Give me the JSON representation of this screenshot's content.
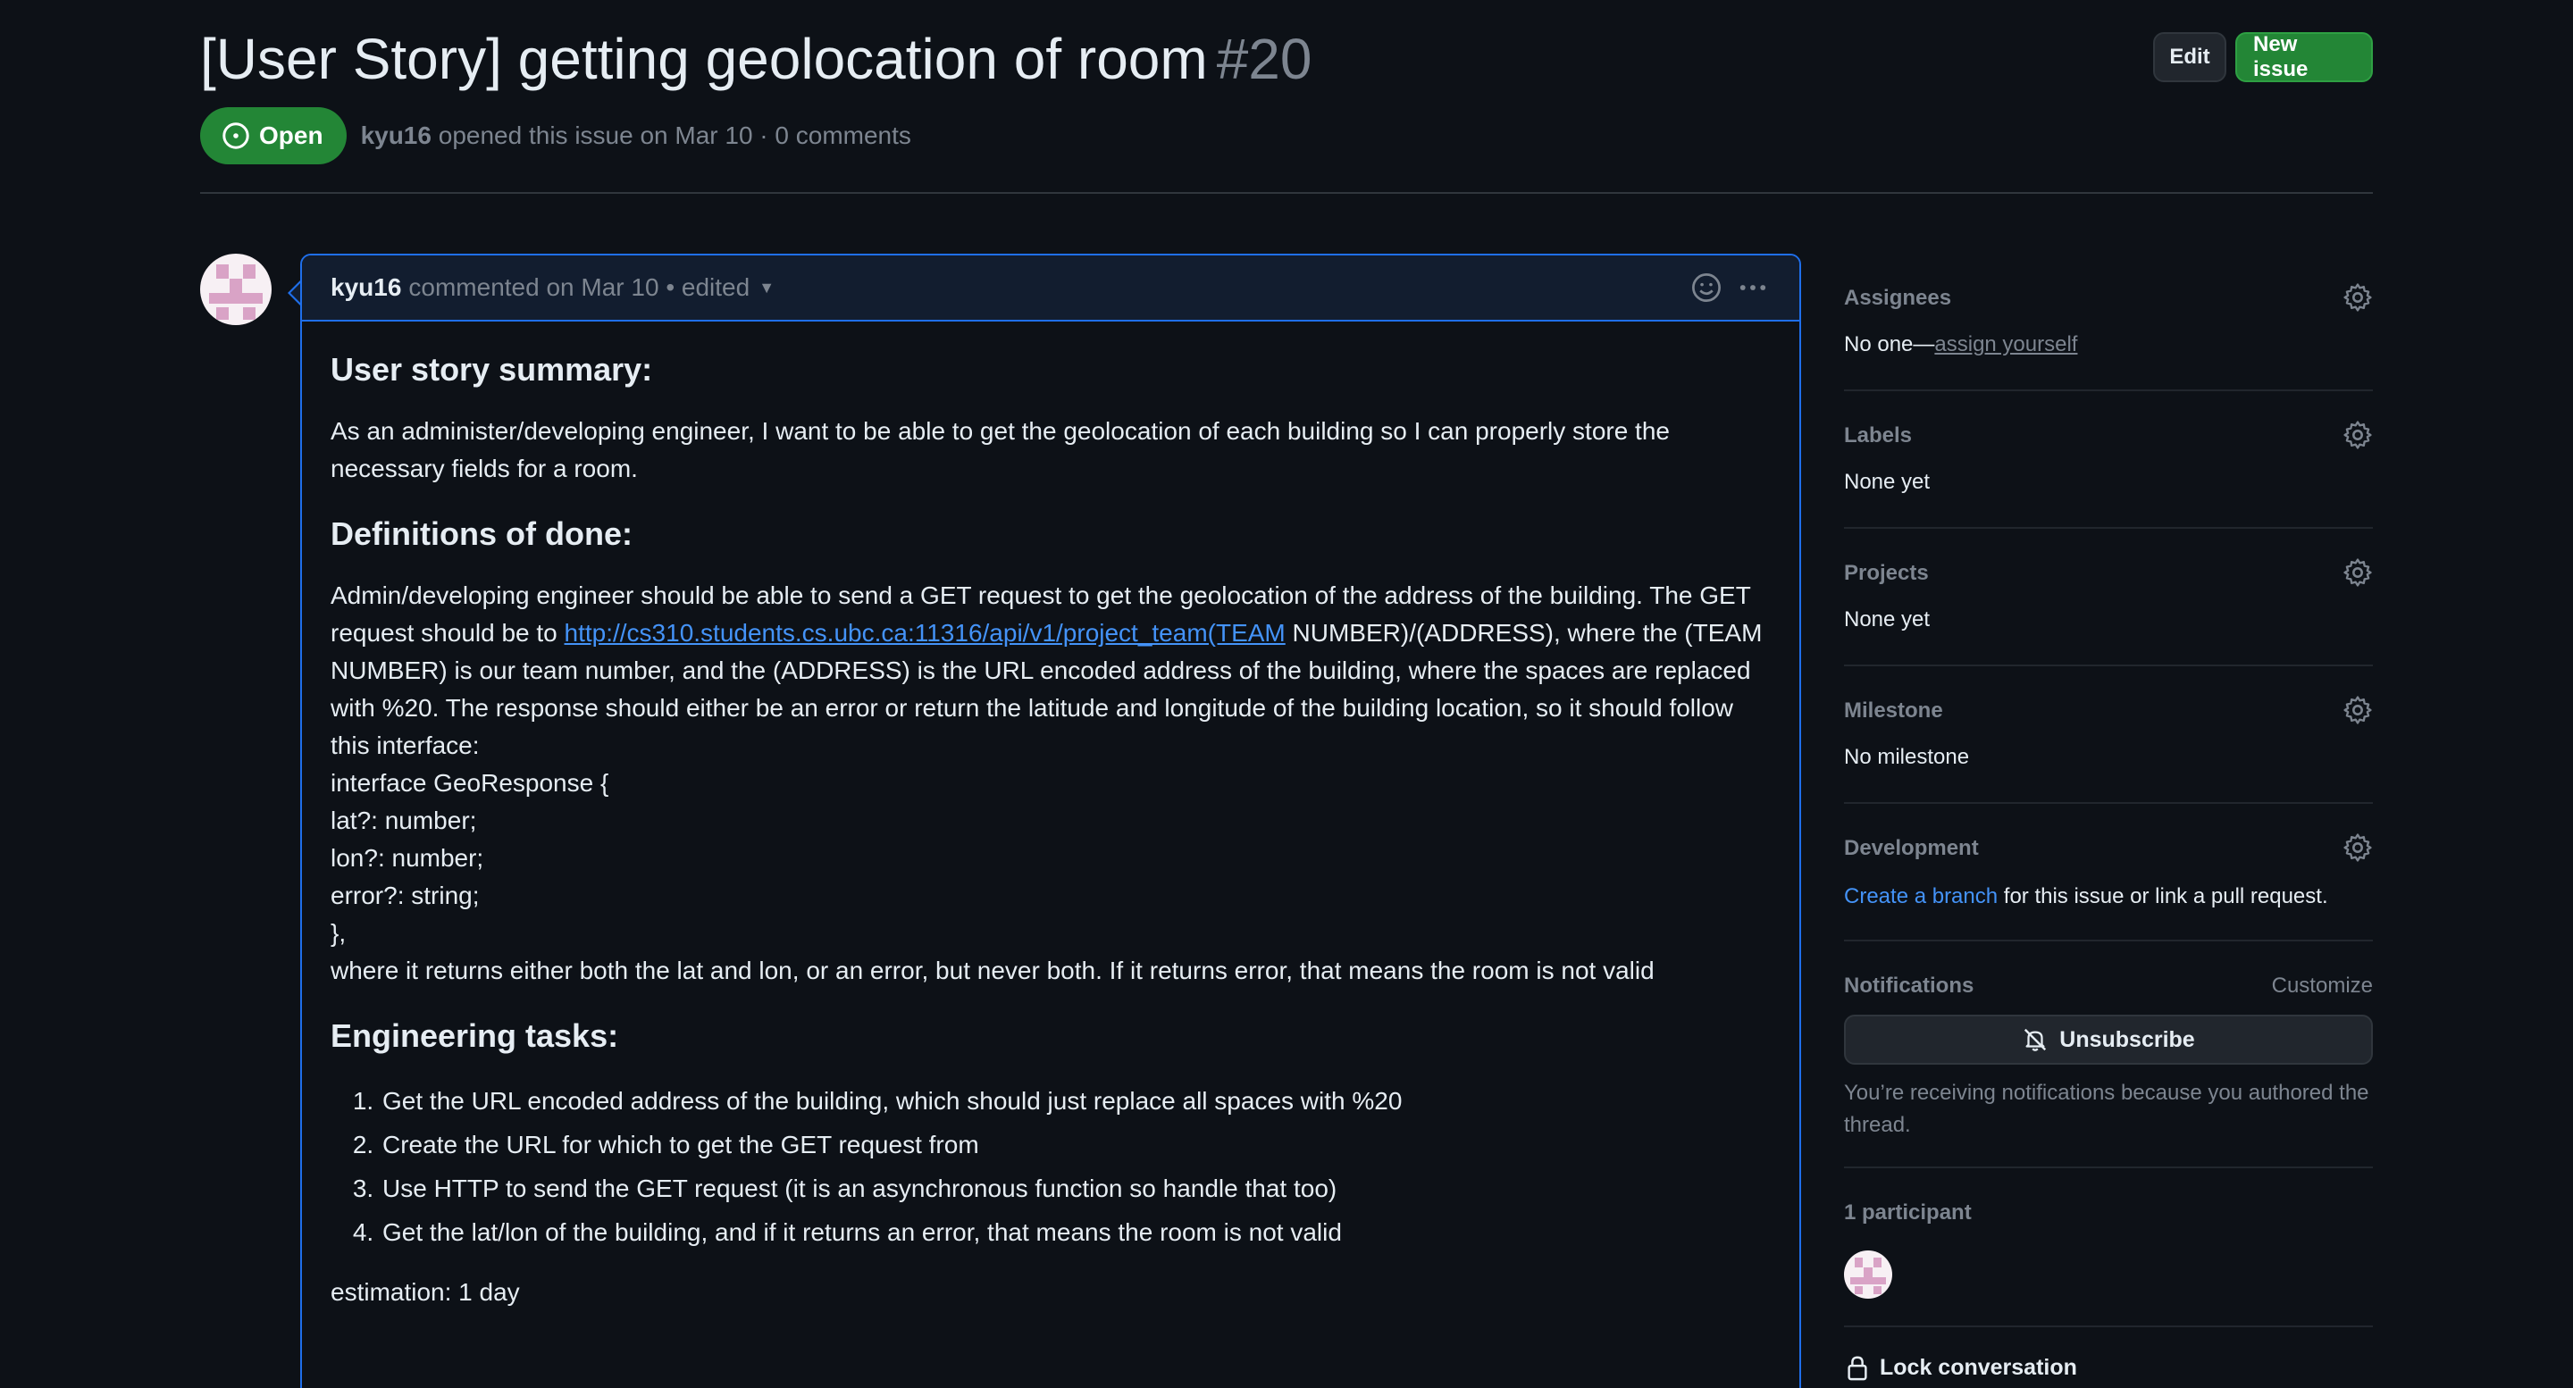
{
  "issue": {
    "title": "[User Story] getting geolocation of room",
    "number": "#20",
    "state": "Open",
    "author": "kyu16",
    "meta_rest": "opened this issue on Mar 10 · 0 comments"
  },
  "header_actions": {
    "edit_label": "Edit",
    "new_issue_label": "New issue"
  },
  "comment": {
    "author": "kyu16",
    "meta": "commented on Mar 10 • edited",
    "summary_heading": "User story summary:",
    "summary_text": "As an administer/developing engineer, I want to be able to get the geolocation of each building so I can properly store the necessary fields for a room.",
    "done_heading": "Definitions of done:",
    "done_text_before_link": "Admin/developing engineer should be able to send a GET request to get the geolocation of the address of the building. The GET request should be to ",
    "done_link": "http://cs310.students.cs.ubc.ca:11316/api/v1/project_team(TEAM",
    "done_text_after_link": " NUMBER)/(ADDRESS), where the (TEAM NUMBER) is our team number, and the (ADDRESS) is the URL encoded address of the building, where the spaces are replaced with %20. The response should either be an error or return the latitude and longitude of the building location, so it should follow this interface:",
    "code_lines": [
      "interface GeoResponse {",
      "lat?: number;",
      "lon?: number;",
      "error?: string;",
      "},",
      "where it returns either both the lat and lon, or an error, but never both. If it returns error, that means the room is not valid"
    ],
    "tasks_heading": "Engineering tasks:",
    "tasks": [
      "Get the URL encoded address of the building, which should just replace all spaces with %20",
      "Create the URL for which to get the GET request from",
      "Use HTTP to send the GET request (it is an asynchronous function so handle that too)",
      "Get the lat/lon of the building, and if it returns an error, that means the room is not valid"
    ],
    "estimation": "estimation: 1 day"
  },
  "sidebar": {
    "assignees": {
      "heading": "Assignees",
      "value": "No one—",
      "link": "assign yourself"
    },
    "labels": {
      "heading": "Labels",
      "value": "None yet"
    },
    "projects": {
      "heading": "Projects",
      "value": "None yet"
    },
    "milestone": {
      "heading": "Milestone",
      "value": "No milestone"
    },
    "development": {
      "heading": "Development",
      "link": "Create a branch",
      "rest": " for this issue or link a pull request."
    },
    "notifications": {
      "heading": "Notifications",
      "customize": "Customize",
      "unsubscribe": "Unsubscribe",
      "note": "You’re receiving notifications because you authored the thread."
    },
    "participants": {
      "heading": "1 participant"
    },
    "lock": {
      "label": "Lock conversation"
    }
  },
  "colors": {
    "background": "#0d1117",
    "accent_blue": "#1f6feb",
    "open_green": "#238636",
    "link": "#4493f8",
    "muted": "#7d8590"
  },
  "icons": {
    "state": "issue-opened-icon",
    "reaction": "smiley-icon",
    "more": "kebab-horizontal-icon",
    "settings": "gear-icon",
    "unsubscribe": "bell-slash-icon",
    "lock": "lock-icon"
  }
}
